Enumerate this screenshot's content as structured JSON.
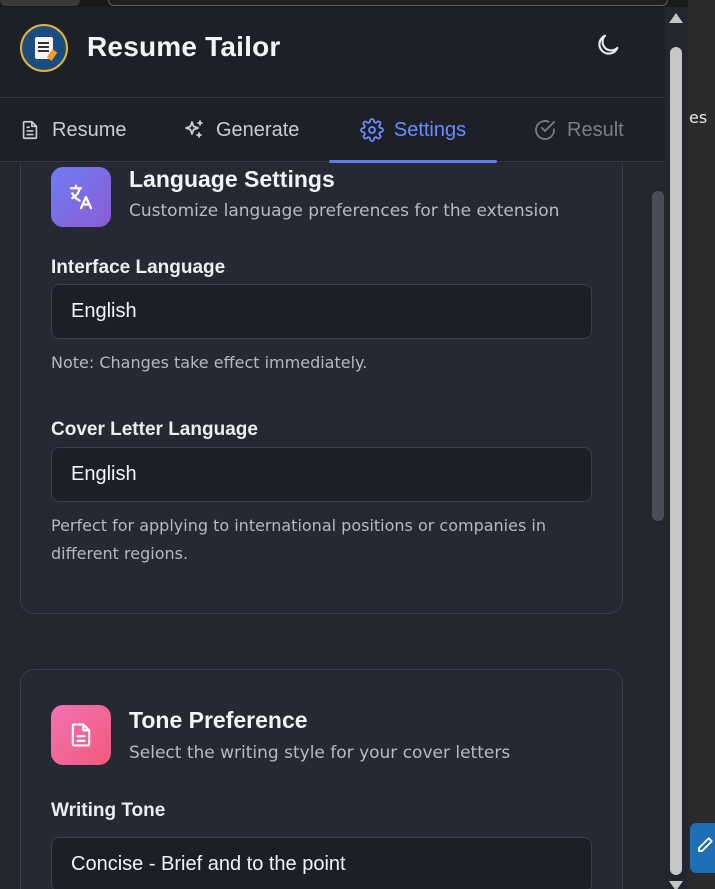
{
  "app": {
    "title": "Resume Tailor"
  },
  "tabs": [
    {
      "label": "Resume",
      "icon": "document-icon",
      "active": false
    },
    {
      "label": "Generate",
      "icon": "sparkles-icon",
      "active": false
    },
    {
      "label": "Settings",
      "icon": "gear-icon",
      "active": true
    },
    {
      "label": "Result",
      "icon": "check-circle-icon",
      "active": false
    }
  ],
  "language_card": {
    "title": "Language Settings",
    "subtitle": "Customize language preferences for the extension",
    "icon": "translate-icon",
    "interface_label": "Interface Language",
    "interface_value": "English",
    "interface_note": "Note: Changes take effect immediately.",
    "cover_label": "Cover Letter Language",
    "cover_value": "English",
    "cover_note": "Perfect for applying to international positions or companies in different regions."
  },
  "tone_card": {
    "title": "Tone Preference",
    "subtitle": "Select the writing style for your cover letters",
    "icon": "file-text-icon",
    "tone_label": "Writing Tone",
    "tone_value": "Concise - Brief and to the point"
  },
  "background": {
    "peek_text": "es"
  },
  "colors": {
    "accent": "#5b7cf5",
    "panel_bg": "#23252f",
    "card_bg": "#262833"
  }
}
